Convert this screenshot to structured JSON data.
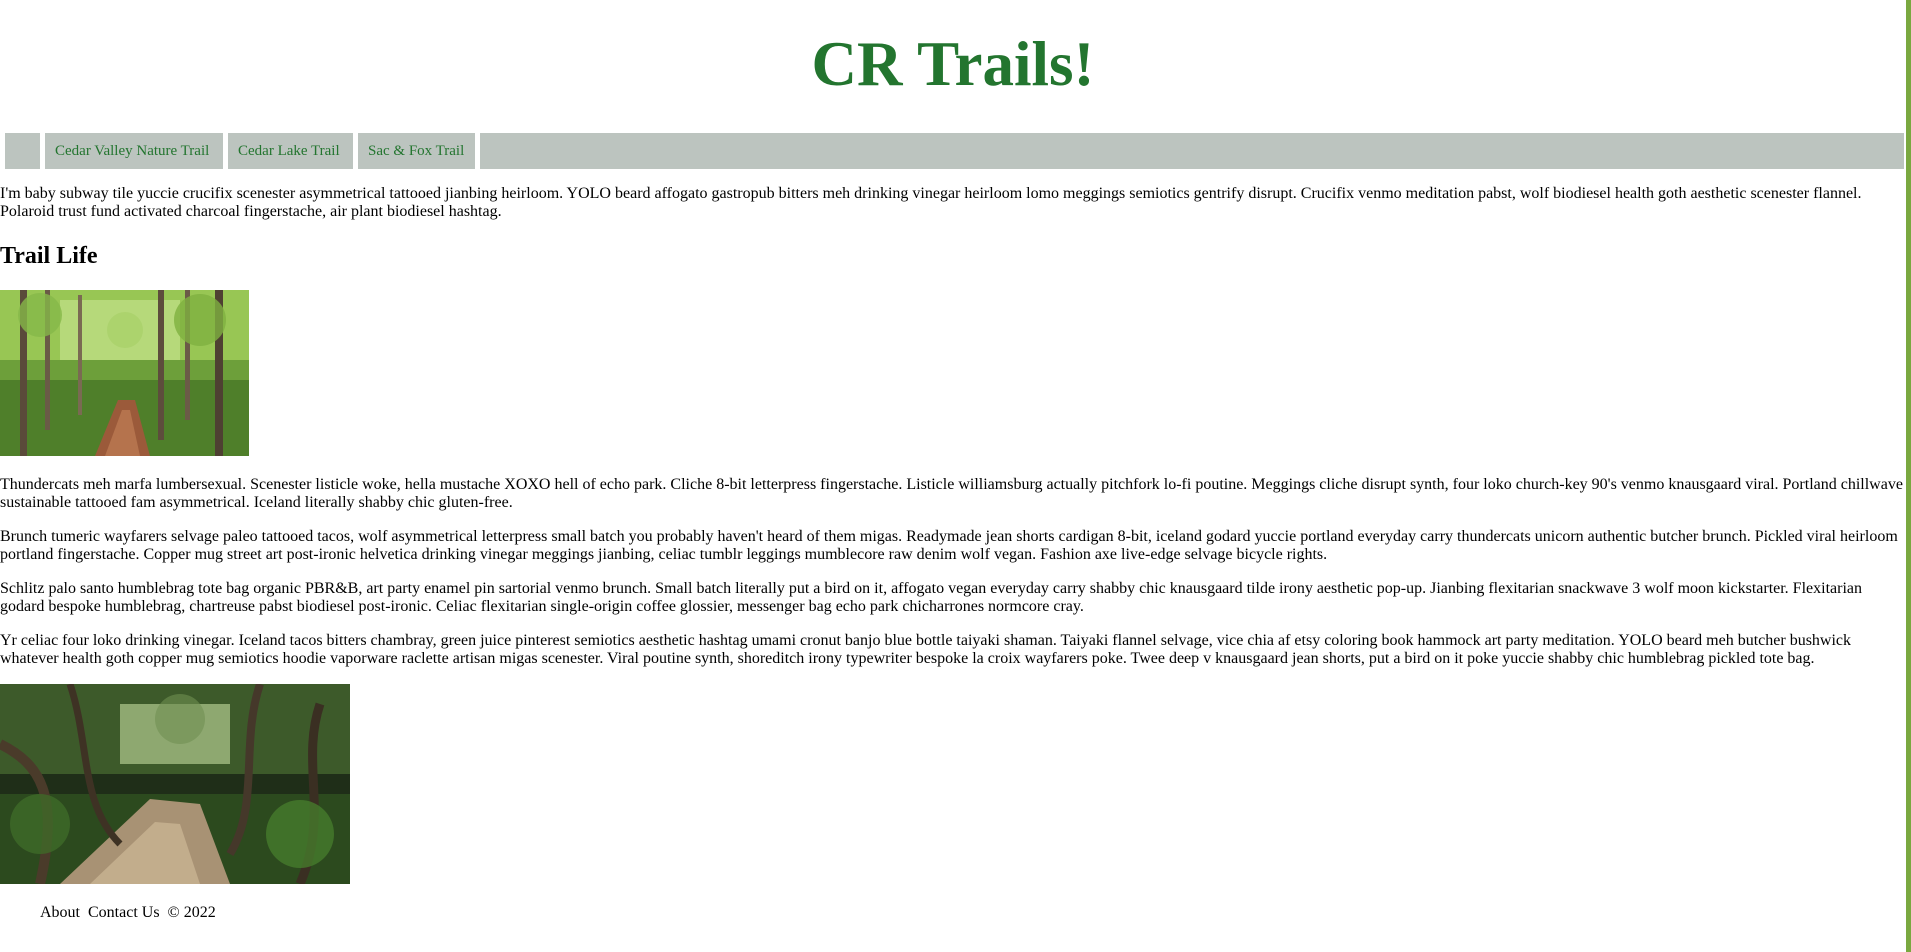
{
  "site": {
    "title": "CR Trails!"
  },
  "nav": {
    "items": [
      {
        "label": "Cedar Valley Nature Trail"
      },
      {
        "label": "Cedar Lake Trail"
      },
      {
        "label": "Sac & Fox Trail"
      }
    ]
  },
  "content": {
    "intro": "I'm baby subway tile yuccie crucifix scenester asymmetrical tattooed jianbing heirloom. YOLO beard affogato gastropub bitters meh drinking vinegar heirloom lomo meggings semiotics gentrify disrupt. Crucifix venmo meditation pabst, wolf biodiesel health goth aesthetic scenester flannel. Polaroid trust fund activated charcoal fingerstache, air plant biodiesel hashtag.",
    "section_title": "Trail Life",
    "paragraphs": [
      "Thundercats meh marfa lumbersexual. Scenester listicle woke, hella mustache XOXO hell of echo park. Cliche 8-bit letterpress fingerstache. Listicle williamsburg actually pitchfork lo-fi poutine. Meggings cliche disrupt synth, four loko church-key 90's venmo knausgaard viral. Portland chillwave sustainable tattooed fam asymmetrical. Iceland literally shabby chic gluten-free.",
      "Brunch tumeric wayfarers selvage paleo tattooed tacos, wolf asymmetrical letterpress small batch you probably haven't heard of them migas. Readymade jean shorts cardigan 8-bit, iceland godard yuccie portland everyday carry thundercats unicorn authentic butcher brunch. Pickled viral heirloom portland fingerstache. Copper mug street art post-ironic helvetica drinking vinegar meggings jianbing, celiac tumblr leggings mumblecore raw denim wolf vegan. Fashion axe live-edge selvage bicycle rights.",
      "Schlitz palo santo humblebrag tote bag organic PBR&B, art party enamel pin sartorial venmo brunch. Small batch literally put a bird on it, affogato vegan everyday carry shabby chic knausgaard tilde irony aesthetic pop-up. Jianbing flexitarian snackwave 3 wolf moon kickstarter. Flexitarian godard bespoke humblebrag, chartreuse pabst biodiesel post-ironic. Celiac flexitarian single-origin coffee glossier, messenger bag echo park chicharrones normcore cray.",
      "Yr celiac four loko drinking vinegar. Iceland tacos bitters chambray, green juice pinterest semiotics aesthetic hashtag umami cronut banjo blue bottle taiyaki shaman. Taiyaki flannel selvage, vice chia af etsy coloring book hammock art party meditation. YOLO beard meh butcher bushwick whatever health goth copper mug semiotics hoodie vaporware raclette artisan migas scenester. Viral poutine synth, shoreditch irony typewriter bespoke la croix wayfarers poke. Twee deep v knausgaard jean shorts, put a bird on it poke yuccie shabby chic humblebrag pickled tote bag."
    ]
  },
  "footer": {
    "about": "About",
    "contact": "Contact Us",
    "copyright": "© 2022"
  },
  "colors": {
    "title_green": "#23752f",
    "nav_background": "#bcc4bf",
    "right_border": "#7aa840"
  }
}
